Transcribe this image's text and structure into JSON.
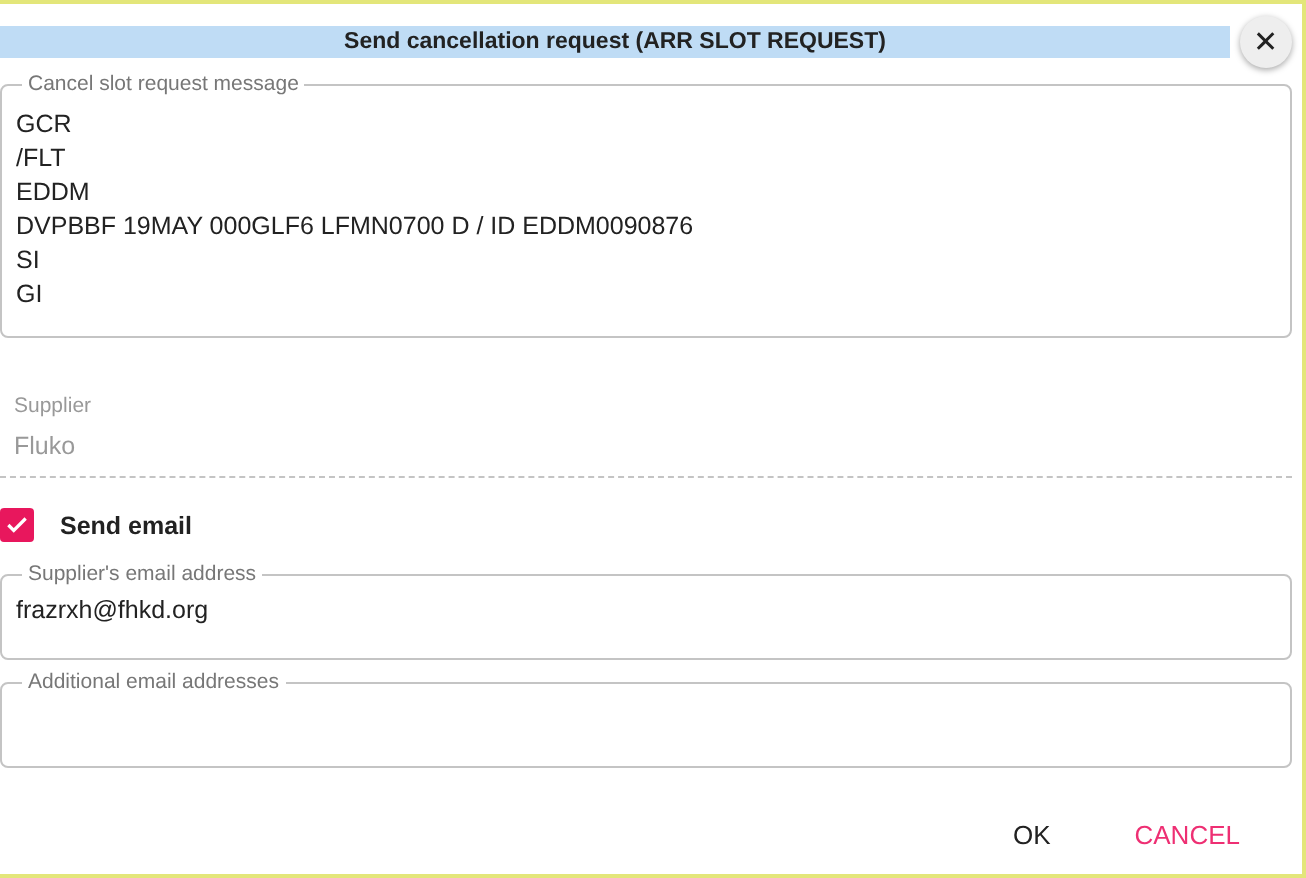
{
  "dialog": {
    "title": "Send cancellation request (ARR SLOT REQUEST)",
    "close": "✕"
  },
  "message_field": {
    "label": "Cancel slot request message",
    "value": "GCR\n/FLT\nEDDM\nDVPBBF 19MAY 000GLF6 LFMN0700 D / ID EDDM0090876\nSI\nGI"
  },
  "supplier": {
    "label": "Supplier",
    "value": "Fluko",
    "disabled": true
  },
  "send_email": {
    "label": "Send email",
    "checked": true
  },
  "email_fields": [
    {
      "label": "Supplier's email address",
      "value": "frazrxh@fhkd.org"
    },
    {
      "label": "Additional email addresses"
    }
  ],
  "buttons": [
    {
      "label": "OK",
      "kind": "primary"
    },
    {
      "label": "CANCEL",
      "kind": "cancel"
    }
  ]
}
